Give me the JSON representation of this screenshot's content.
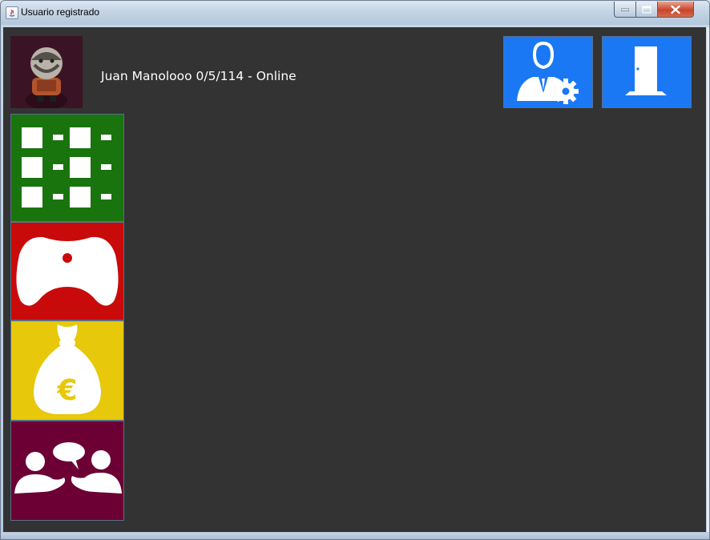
{
  "window": {
    "title": "Usuario registrado",
    "controls": [
      "minimize-icon",
      "maximize-icon",
      "close-icon"
    ]
  },
  "user": {
    "status_line": "Juan Manolooo 0/5/114 - Online"
  },
  "tiles": {
    "profile_settings": {
      "icon": "user-gear-icon",
      "color": "#1a78f5"
    },
    "exit": {
      "icon": "door-icon",
      "color": "#1a78f5"
    },
    "grid": {
      "icon": "grid-list-icon",
      "color": "#19740e"
    },
    "games": {
      "icon": "gamepad-icon",
      "color": "#c90a0a"
    },
    "money": {
      "icon": "euro-moneybag-icon",
      "color": "#e7c80b"
    },
    "chat": {
      "icon": "people-chat-icon",
      "color": "#6c0035"
    }
  },
  "colors": {
    "background": "#333333",
    "text": "#ffffff"
  }
}
